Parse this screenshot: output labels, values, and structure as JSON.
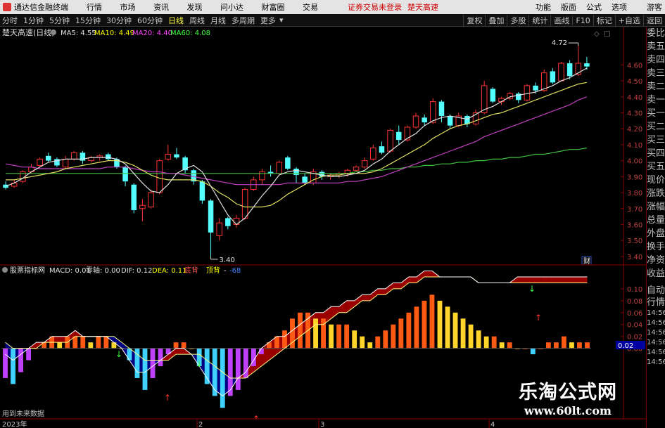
{
  "titlebar": {
    "app_name": "通达信金融终端",
    "menu": [
      "行情",
      "市场",
      "资讯",
      "发现",
      "问小达",
      "财富圈",
      "交易"
    ],
    "warning": "证券交易未登录",
    "stock_name": "楚天高速",
    "right_menu": [
      "功能",
      "版面",
      "公式",
      "选项"
    ],
    "user": "游客"
  },
  "toolbar": {
    "periods": [
      "分时",
      "1分钟",
      "5分钟",
      "15分钟",
      "30分钟",
      "60分钟",
      "日线",
      "周线",
      "月线",
      "多周期",
      "更多"
    ],
    "active": "日线",
    "right": [
      "复权",
      "叠加",
      "多股",
      "统计",
      "画线",
      "F10",
      "标记",
      "+自选",
      "返回"
    ]
  },
  "main_panel": {
    "title": "楚天高速(日线)",
    "ma": [
      {
        "label": "MA5: 4.55",
        "color": "#e0e0e0"
      },
      {
        "label": "MA10: 4.49",
        "color": "#ffff00"
      },
      {
        "label": "MA20: 4.40",
        "color": "#ff40ff"
      },
      {
        "label": "MA60: 4.08",
        "color": "#40ff40"
      }
    ],
    "high_label": "4.72",
    "low_label": "3.40",
    "fin_badge": "财",
    "price_ticks": [
      "4.60",
      "4.50",
      "4.40",
      "4.30",
      "4.20",
      "4.10",
      "4.00",
      "3.90",
      "3.80",
      "3.70",
      "3.60",
      "3.50",
      "3.40"
    ]
  },
  "sub_panel": {
    "title": "股票指标网",
    "macd": "MACD: 0.01",
    "zero": "零轴: 0.00",
    "dif": "DIF: 0.12",
    "dea": "DEA: 0.11",
    "label_a": "底背",
    "label_b": "顶背",
    "label_c": "-",
    "label_d": "-68",
    "ticks": [
      "0.10",
      "0.08",
      "0.06",
      "0.04",
      "0.02",
      "0.00"
    ],
    "current_value": "0.02",
    "future_hint": "用到未来数据"
  },
  "time_axis": {
    "labels": [
      "2023年",
      "2",
      "3",
      "4"
    ]
  },
  "side_panel": {
    "items": [
      "委比",
      "卖五",
      "卖四",
      "卖三",
      "卖二",
      "卖一",
      "买一",
      "买二",
      "买三",
      "买四",
      "买五",
      "现价",
      "涨跌",
      "涨幅",
      "总量",
      "外盘",
      "换手",
      "净资",
      "收益"
    ],
    "items2": [
      "自动",
      "行情",
      "14:56",
      "14:56",
      "14:56",
      "14:56",
      "14:56",
      "14:56"
    ]
  },
  "watermark": {
    "cn": "乐淘公式网",
    "url": "www.60lt.com"
  },
  "chart_data": {
    "type": "candlestick",
    "candles": [
      {
        "o": 3.85,
        "c": 3.83,
        "h": 3.87,
        "l": 3.82
      },
      {
        "o": 3.84,
        "c": 3.86,
        "h": 3.88,
        "l": 3.83
      },
      {
        "o": 3.87,
        "c": 3.93,
        "h": 3.94,
        "l": 3.86
      },
      {
        "o": 3.93,
        "c": 3.96,
        "h": 3.98,
        "l": 3.92
      },
      {
        "o": 3.97,
        "c": 4.01,
        "h": 4.02,
        "l": 3.96
      },
      {
        "o": 4.03,
        "c": 4.0,
        "h": 4.05,
        "l": 3.99
      },
      {
        "o": 4.01,
        "c": 3.97,
        "h": 4.02,
        "l": 3.96
      },
      {
        "o": 3.96,
        "c": 4.01,
        "h": 4.03,
        "l": 3.95
      },
      {
        "o": 4.01,
        "c": 4.05,
        "h": 4.06,
        "l": 4.0
      },
      {
        "o": 4.05,
        "c": 4.0,
        "h": 4.06,
        "l": 3.98
      },
      {
        "o": 4.0,
        "c": 4.02,
        "h": 4.03,
        "l": 3.99
      },
      {
        "o": 4.02,
        "c": 4.03,
        "h": 4.04,
        "l": 4.0
      },
      {
        "o": 4.04,
        "c": 4.01,
        "h": 4.05,
        "l": 4.0
      },
      {
        "o": 4.01,
        "c": 3.96,
        "h": 4.02,
        "l": 3.95
      },
      {
        "o": 3.96,
        "c": 3.87,
        "h": 3.97,
        "l": 3.84
      },
      {
        "o": 3.85,
        "c": 3.69,
        "h": 3.86,
        "l": 3.67
      },
      {
        "o": 3.7,
        "c": 3.72,
        "h": 3.76,
        "l": 3.62
      },
      {
        "o": 3.71,
        "c": 3.8,
        "h": 3.82,
        "l": 3.7
      },
      {
        "o": 3.8,
        "c": 4.0,
        "h": 4.01,
        "l": 3.79
      },
      {
        "o": 4.01,
        "c": 4.04,
        "h": 4.1,
        "l": 4.0
      },
      {
        "o": 4.04,
        "c": 4.02,
        "h": 4.08,
        "l": 4.01
      },
      {
        "o": 4.02,
        "c": 3.94,
        "h": 4.03,
        "l": 3.92
      },
      {
        "o": 3.94,
        "c": 3.87,
        "h": 3.95,
        "l": 3.85
      },
      {
        "o": 3.87,
        "c": 3.75,
        "h": 3.88,
        "l": 3.73
      },
      {
        "o": 3.75,
        "c": 3.55,
        "h": 3.76,
        "l": 3.4
      },
      {
        "o": 3.53,
        "c": 3.61,
        "h": 3.64,
        "l": 3.5
      },
      {
        "o": 3.64,
        "c": 3.59,
        "h": 3.65,
        "l": 3.57
      },
      {
        "o": 3.6,
        "c": 3.64,
        "h": 3.66,
        "l": 3.58
      },
      {
        "o": 3.64,
        "c": 3.82,
        "h": 3.83,
        "l": 3.63
      },
      {
        "o": 3.82,
        "c": 3.88,
        "h": 3.9,
        "l": 3.81
      },
      {
        "o": 3.88,
        "c": 3.93,
        "h": 3.95,
        "l": 3.85
      },
      {
        "o": 3.93,
        "c": 3.92,
        "h": 3.97,
        "l": 3.9
      },
      {
        "o": 3.92,
        "c": 3.99,
        "h": 4.0,
        "l": 3.91
      },
      {
        "o": 4.02,
        "c": 3.95,
        "h": 4.03,
        "l": 3.94
      },
      {
        "o": 3.95,
        "c": 3.91,
        "h": 3.96,
        "l": 3.86
      },
      {
        "o": 3.9,
        "c": 3.86,
        "h": 3.92,
        "l": 3.85
      },
      {
        "o": 3.86,
        "c": 3.93,
        "h": 3.95,
        "l": 3.85
      },
      {
        "o": 3.93,
        "c": 3.9,
        "h": 3.94,
        "l": 3.88
      },
      {
        "o": 3.9,
        "c": 3.91,
        "h": 3.92,
        "l": 3.88
      },
      {
        "o": 3.91,
        "c": 3.92,
        "h": 3.93,
        "l": 3.89
      },
      {
        "o": 3.92,
        "c": 3.94,
        "h": 3.95,
        "l": 3.9
      },
      {
        "o": 3.94,
        "c": 3.96,
        "h": 3.97,
        "l": 3.93
      },
      {
        "o": 3.96,
        "c": 4.0,
        "h": 4.02,
        "l": 3.95
      },
      {
        "o": 4.01,
        "c": 4.08,
        "h": 4.1,
        "l": 4.0
      },
      {
        "o": 4.09,
        "c": 4.05,
        "h": 4.12,
        "l": 4.04
      },
      {
        "o": 4.06,
        "c": 4.19,
        "h": 4.2,
        "l": 4.05
      },
      {
        "o": 4.18,
        "c": 4.13,
        "h": 4.22,
        "l": 4.1
      },
      {
        "o": 4.13,
        "c": 4.21,
        "h": 4.22,
        "l": 4.12
      },
      {
        "o": 4.21,
        "c": 4.28,
        "h": 4.3,
        "l": 4.2
      },
      {
        "o": 4.27,
        "c": 4.24,
        "h": 4.29,
        "l": 4.22
      },
      {
        "o": 4.24,
        "c": 4.37,
        "h": 4.39,
        "l": 4.23
      },
      {
        "o": 4.37,
        "c": 4.28,
        "h": 4.38,
        "l": 4.24
      },
      {
        "o": 4.28,
        "c": 4.22,
        "h": 4.29,
        "l": 4.2
      },
      {
        "o": 4.22,
        "c": 4.28,
        "h": 4.3,
        "l": 4.21
      },
      {
        "o": 4.28,
        "c": 4.23,
        "h": 4.29,
        "l": 4.21
      },
      {
        "o": 4.23,
        "c": 4.3,
        "h": 4.32,
        "l": 4.22
      },
      {
        "o": 4.3,
        "c": 4.47,
        "h": 4.5,
        "l": 4.29
      },
      {
        "o": 4.45,
        "c": 4.37,
        "h": 4.46,
        "l": 4.36
      },
      {
        "o": 4.37,
        "c": 4.39,
        "h": 4.4,
        "l": 4.35
      },
      {
        "o": 4.39,
        "c": 4.42,
        "h": 4.43,
        "l": 4.38
      },
      {
        "o": 4.42,
        "c": 4.38,
        "h": 4.43,
        "l": 4.36
      },
      {
        "o": 4.38,
        "c": 4.47,
        "h": 4.48,
        "l": 4.37
      },
      {
        "o": 4.47,
        "c": 4.44,
        "h": 4.49,
        "l": 4.42
      },
      {
        "o": 4.44,
        "c": 4.55,
        "h": 4.57,
        "l": 4.43
      },
      {
        "o": 4.56,
        "c": 4.49,
        "h": 4.58,
        "l": 4.48
      },
      {
        "o": 4.5,
        "c": 4.61,
        "h": 4.62,
        "l": 4.5
      },
      {
        "o": 4.61,
        "c": 4.53,
        "h": 4.63,
        "l": 4.51
      },
      {
        "o": 4.54,
        "c": 4.61,
        "h": 4.72,
        "l": 4.53
      },
      {
        "o": 4.61,
        "c": 4.59,
        "h": 4.65,
        "l": 4.57
      }
    ],
    "ma5": [
      3.84,
      3.86,
      3.89,
      3.93,
      3.96,
      3.99,
      4.0,
      4.01,
      4.01,
      4.01,
      4.02,
      4.02,
      4.02,
      4.01,
      3.98,
      3.92,
      3.86,
      3.81,
      3.8,
      3.85,
      3.92,
      3.95,
      3.97,
      3.93,
      3.84,
      3.75,
      3.66,
      3.6,
      3.64,
      3.71,
      3.78,
      3.84,
      3.91,
      3.93,
      3.94,
      3.93,
      3.92,
      3.91,
      3.9,
      3.9,
      3.91,
      3.92,
      3.94,
      3.98,
      4.01,
      4.06,
      4.1,
      4.14,
      4.17,
      4.22,
      4.25,
      4.27,
      4.28,
      4.27,
      4.26,
      4.29,
      4.32,
      4.34,
      4.37,
      4.4,
      4.41,
      4.42,
      4.43,
      4.45,
      4.47,
      4.5,
      4.52,
      4.55,
      4.58
    ],
    "ma10": [
      3.88,
      3.88,
      3.89,
      3.9,
      3.91,
      3.92,
      3.93,
      3.95,
      3.96,
      3.97,
      3.98,
      3.99,
      4.0,
      4.0,
      3.99,
      3.97,
      3.94,
      3.91,
      3.89,
      3.88,
      3.88,
      3.88,
      3.88,
      3.87,
      3.84,
      3.8,
      3.77,
      3.73,
      3.71,
      3.71,
      3.71,
      3.72,
      3.75,
      3.79,
      3.82,
      3.85,
      3.88,
      3.9,
      3.91,
      3.91,
      3.92,
      3.92,
      3.92,
      3.93,
      3.95,
      3.98,
      4.01,
      4.04,
      4.07,
      4.1,
      4.14,
      4.17,
      4.2,
      4.22,
      4.23,
      4.25,
      4.27,
      4.29,
      4.3,
      4.32,
      4.34,
      4.36,
      4.38,
      4.4,
      4.42,
      4.44,
      4.46,
      4.48,
      4.49
    ],
    "ma20": [
      3.98,
      3.97,
      3.96,
      3.96,
      3.95,
      3.95,
      3.95,
      3.95,
      3.95,
      3.95,
      3.95,
      3.95,
      3.96,
      3.96,
      3.96,
      3.95,
      3.94,
      3.93,
      3.93,
      3.92,
      3.92,
      3.91,
      3.9,
      3.89,
      3.88,
      3.87,
      3.86,
      3.85,
      3.85,
      3.85,
      3.85,
      3.85,
      3.85,
      3.86,
      3.86,
      3.86,
      3.86,
      3.86,
      3.86,
      3.86,
      3.87,
      3.87,
      3.88,
      3.89,
      3.9,
      3.92,
      3.94,
      3.96,
      3.98,
      4.0,
      4.02,
      4.04,
      4.06,
      4.08,
      4.1,
      4.12,
      4.15,
      4.17,
      4.19,
      4.21,
      4.23,
      4.25,
      4.27,
      4.29,
      4.31,
      4.33,
      4.35,
      4.38,
      4.4
    ],
    "ma60": [
      3.92,
      3.92,
      3.92,
      3.92,
      3.92,
      3.92,
      3.92,
      3.92,
      3.92,
      3.92,
      3.92,
      3.92,
      3.92,
      3.92,
      3.92,
      3.92,
      3.92,
      3.92,
      3.92,
      3.92,
      3.92,
      3.92,
      3.92,
      3.92,
      3.92,
      3.92,
      3.92,
      3.92,
      3.92,
      3.92,
      3.92,
      3.92,
      3.92,
      3.92,
      3.92,
      3.92,
      3.92,
      3.92,
      3.92,
      3.92,
      3.92,
      3.93,
      3.93,
      3.94,
      3.94,
      3.95,
      3.95,
      3.96,
      3.96,
      3.97,
      3.97,
      3.98,
      3.98,
      3.99,
      3.99,
      4.0,
      4.0,
      4.01,
      4.01,
      4.02,
      4.02,
      4.03,
      4.04,
      4.04,
      4.05,
      4.06,
      4.07,
      4.07,
      4.08
    ],
    "macd_bars": [
      -0.05,
      -0.06,
      -0.04,
      -0.02,
      0.0,
      0.01,
      0.02,
      0.01,
      0.02,
      0.02,
      0.02,
      0.01,
      0.02,
      0.02,
      0.01,
      0.0,
      -0.02,
      -0.05,
      -0.07,
      -0.05,
      -0.03,
      -0.01,
      0.01,
      0.01,
      0.0,
      -0.03,
      -0.06,
      -0.08,
      -0.1,
      -0.08,
      -0.07,
      -0.05,
      -0.03,
      -0.01,
      0.01,
      0.02,
      0.03,
      0.05,
      0.06,
      0.06,
      0.05,
      0.05,
      0.04,
      0.04,
      0.04,
      0.03,
      0.02,
      0.01,
      0.02,
      0.03,
      0.04,
      0.05,
      0.06,
      0.07,
      0.08,
      0.09,
      0.08,
      0.07,
      0.06,
      0.05,
      0.04,
      0.03,
      0.02,
      0.02,
      0.01,
      0.01,
      0.0,
      0.0,
      -0.01,
      0.0,
      0.01,
      0.01,
      0.02,
      0.01,
      0.01,
      0.01
    ],
    "dif": [
      -0.01,
      -0.02,
      -0.01,
      0.0,
      0.01,
      0.01,
      0.02,
      0.02,
      0.02,
      0.03,
      0.02,
      0.02,
      0.02,
      0.02,
      0.01,
      0.0,
      -0.02,
      -0.04,
      -0.04,
      -0.03,
      -0.02,
      -0.01,
      0.0,
      0.0,
      -0.01,
      -0.03,
      -0.05,
      -0.07,
      -0.08,
      -0.07,
      -0.05,
      -0.04,
      -0.02,
      0.0,
      0.01,
      0.02,
      0.02,
      0.03,
      0.04,
      0.05,
      0.06,
      0.06,
      0.07,
      0.07,
      0.08,
      0.08,
      0.09,
      0.09,
      0.1,
      0.1,
      0.11,
      0.11,
      0.12,
      0.12,
      0.13,
      0.13,
      0.12,
      0.12,
      0.12,
      0.12,
      0.12,
      0.11,
      0.11,
      0.11,
      0.11,
      0.11,
      0.12,
      0.12,
      0.12,
      0.12,
      0.12,
      0.12,
      0.12,
      0.12,
      0.12,
      0.12
    ],
    "dea": [
      0.01,
      0.0,
      0.0,
      0.0,
      0.0,
      0.01,
      0.01,
      0.01,
      0.01,
      0.02,
      0.02,
      0.02,
      0.02,
      0.02,
      0.02,
      0.01,
      0.0,
      -0.01,
      -0.02,
      -0.02,
      -0.02,
      -0.02,
      -0.01,
      -0.01,
      -0.01,
      -0.01,
      -0.02,
      -0.03,
      -0.04,
      -0.05,
      -0.05,
      -0.05,
      -0.04,
      -0.03,
      -0.02,
      -0.01,
      0.0,
      0.01,
      0.02,
      0.03,
      0.04,
      0.04,
      0.05,
      0.06,
      0.06,
      0.07,
      0.08,
      0.08,
      0.09,
      0.09,
      0.1,
      0.1,
      0.11,
      0.11,
      0.12,
      0.12,
      0.12,
      0.12,
      0.12,
      0.12,
      0.12,
      0.11,
      0.11,
      0.11,
      0.11,
      0.11,
      0.11,
      0.11,
      0.11,
      0.11,
      0.11,
      0.11,
      0.11,
      0.11,
      0.11,
      0.11
    ],
    "price_range": [
      3.36,
      4.76
    ],
    "macd_range": [
      -0.115,
      0.12
    ]
  }
}
